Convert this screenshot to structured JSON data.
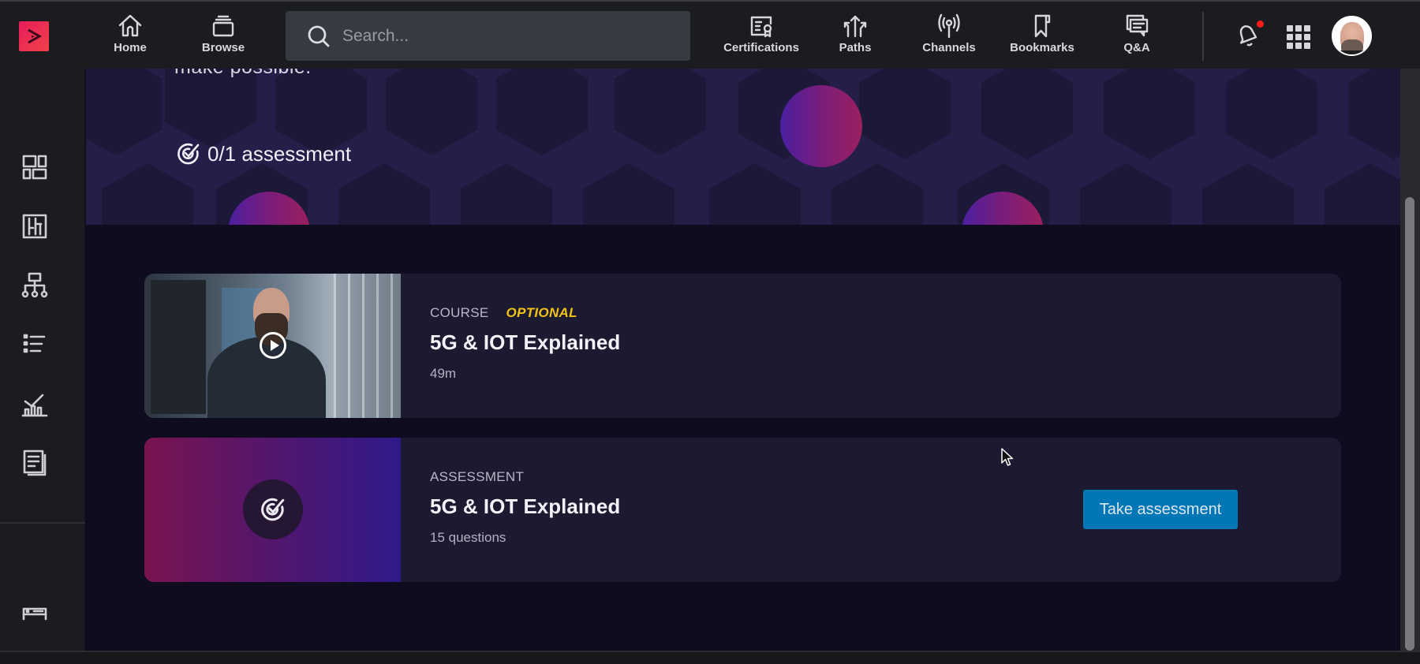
{
  "header": {
    "logo_icon": "play-logo-icon",
    "nav_left": [
      {
        "label": "Home",
        "icon": "home-icon"
      },
      {
        "label": "Browse",
        "icon": "browse-icon"
      }
    ],
    "search": {
      "placeholder": "Search...",
      "value": ""
    },
    "nav_right": [
      {
        "label": "Certifications",
        "icon": "certificate-icon"
      },
      {
        "label": "Paths",
        "icon": "paths-icon"
      },
      {
        "label": "Channels",
        "icon": "broadcast-icon"
      },
      {
        "label": "Bookmarks",
        "icon": "bookmark-icon"
      },
      {
        "label": "Q&A",
        "icon": "chat-icon"
      }
    ],
    "notification_dot_color": "#ff1a1a"
  },
  "sidebar": {
    "items": [
      {
        "icon": "dashboard-icon"
      },
      {
        "icon": "skills-icon"
      },
      {
        "icon": "hierarchy-icon"
      },
      {
        "icon": "list-icon"
      },
      {
        "icon": "analytics-icon"
      },
      {
        "icon": "document-icon"
      }
    ],
    "bottom_icon": "device-icon"
  },
  "hero": {
    "text_fragment": "make possible.",
    "assessment_progress": "0/1 assessment"
  },
  "cards": [
    {
      "kind": "COURSE",
      "tag": "OPTIONAL",
      "title": "5G & IOT Explained",
      "meta": "49m"
    },
    {
      "kind": "ASSESSMENT",
      "title": "5G & IOT Explained",
      "meta": "15 questions",
      "action": "Take assessment"
    }
  ],
  "colors": {
    "accent_button": "#0277b6",
    "optional_tag": "#f2c315",
    "logo": "#e81c5a"
  }
}
